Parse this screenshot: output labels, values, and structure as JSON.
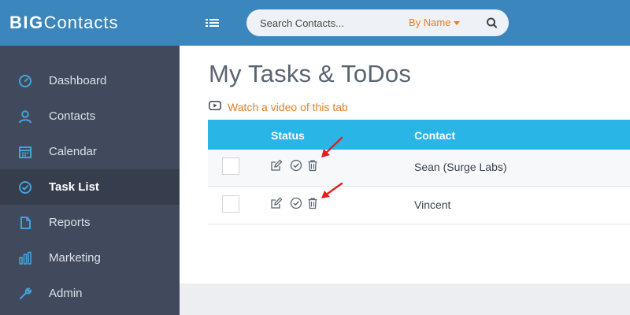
{
  "app": {
    "logo_big": "BIG",
    "logo_rest": "Contacts"
  },
  "search": {
    "placeholder": "Search Contacts...",
    "mode_label": "By Name"
  },
  "sidebar": {
    "items": [
      {
        "label": "Dashboard",
        "icon": "gauge-icon"
      },
      {
        "label": "Contacts",
        "icon": "person-icon"
      },
      {
        "label": "Calendar",
        "icon": "calendar-icon"
      },
      {
        "label": "Task List",
        "icon": "check-circle-icon",
        "active": true
      },
      {
        "label": "Reports",
        "icon": "file-icon"
      },
      {
        "label": "Marketing",
        "icon": "bar-chart-icon"
      },
      {
        "label": "Admin",
        "icon": "wrench-icon"
      }
    ]
  },
  "page": {
    "title": "My Tasks & ToDos",
    "video_link": "Watch a video of this tab"
  },
  "table": {
    "columns": [
      "Status",
      "Contact"
    ],
    "rows": [
      {
        "contact": "Sean (Surge Labs)"
      },
      {
        "contact": "Vincent"
      }
    ]
  },
  "colors": {
    "header": "#3a86bd",
    "sidebar": "#414a5c",
    "sidebar_active": "#363e4e",
    "table_header": "#29b5e6",
    "accent_orange": "#e67e22",
    "annotation_red": "#e02020"
  }
}
